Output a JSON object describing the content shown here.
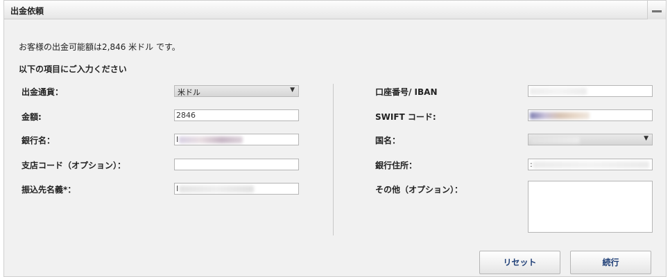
{
  "panel": {
    "title": "出金依頼",
    "collapse_icon": "minimize-icon"
  },
  "intro": "お客様の出金可能額は2,846 米ドル です。",
  "subhead": "以下の項目にご入力ください",
  "left_form": {
    "currency_label": "出金通貨：",
    "currency_value": "米ドル",
    "amount_label": "金額:",
    "amount_value": "2846",
    "bank_name_label": "銀行名：",
    "bank_name_value": "I",
    "branch_code_label": "支店コード（オプション）：",
    "branch_code_value": "",
    "payee_name_label": "振込先名義*：",
    "payee_name_value": "I"
  },
  "right_form": {
    "account_label": "口座番号/ IBAN",
    "account_value": "",
    "swift_label": "SWIFT コード:",
    "swift_value": "",
    "country_label": "国名：",
    "country_value": "",
    "bank_address_label": "銀行住所：",
    "bank_address_value": ":",
    "other_label": "その他（オプション）：",
    "other_value": ""
  },
  "buttons": {
    "reset": "リセット",
    "continue": "続行"
  }
}
